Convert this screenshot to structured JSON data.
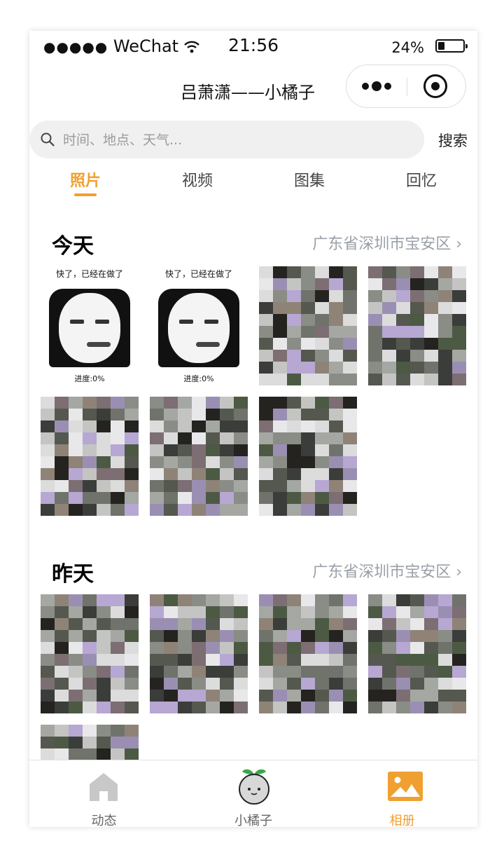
{
  "status_bar": {
    "signal": "●●●●●",
    "carrier": "WeChat",
    "time": "21:56",
    "battery": "24%",
    "battery_level": 0.24
  },
  "navbar": {
    "title": "吕萧潇——小橘子"
  },
  "search": {
    "placeholder": "时间、地点、天气...",
    "button": "搜索"
  },
  "tabs": [
    {
      "label": "照片",
      "active": true
    },
    {
      "label": "视频",
      "active": false
    },
    {
      "label": "图集",
      "active": false
    },
    {
      "label": "回忆",
      "active": false
    }
  ],
  "sections": [
    {
      "day": "今天",
      "location": "广东省深圳市宝安区 ›",
      "memes": [
        {
          "caption": "快了，已经在做了",
          "progress": "进度:0%"
        },
        {
          "caption": "快了，已经在做了",
          "progress": "进度:0%"
        }
      ]
    },
    {
      "day": "昨天",
      "location": "广东省深圳市宝安区 ›"
    }
  ],
  "tabbar": [
    {
      "label": "动态",
      "icon": "house-icon",
      "active": false
    },
    {
      "label": "小橘子",
      "icon": "orange-icon",
      "active": false
    },
    {
      "label": "相册",
      "icon": "album-icon",
      "active": true
    }
  ],
  "colors": {
    "accent": "#f0a030",
    "location_text": "#9aa0a8"
  }
}
